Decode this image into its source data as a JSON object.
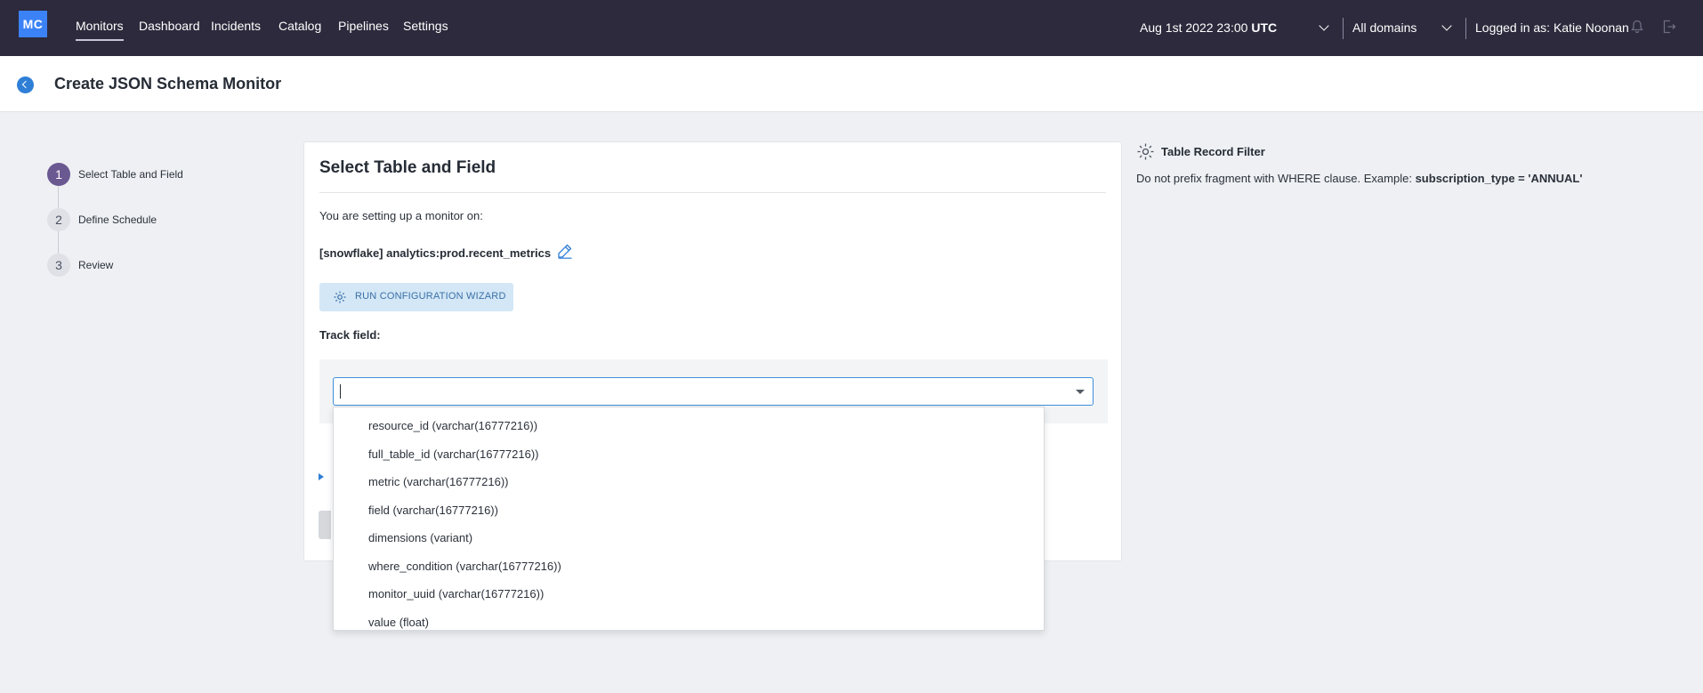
{
  "app": {
    "logo": "MC"
  },
  "nav": {
    "items": [
      "Monitors",
      "Dashboard",
      "Incidents",
      "Catalog",
      "Pipelines",
      "Settings"
    ],
    "active": "Monitors"
  },
  "header": {
    "date": "Aug 1st 2022 23:00",
    "timezone": "UTC",
    "domain_select": "All domains",
    "logged_in": "Logged in as: Katie Noonan"
  },
  "page": {
    "title": "Create JSON Schema Monitor"
  },
  "stepper": {
    "steps": [
      {
        "number": "1",
        "label": "Select Table and Field",
        "active": true
      },
      {
        "number": "2",
        "label": "Define Schedule",
        "active": false
      },
      {
        "number": "3",
        "label": "Review",
        "active": false
      }
    ]
  },
  "card": {
    "title": "Select Table and Field",
    "setup_text": "You are setting up a monitor on:",
    "table_name": "[snowflake] analytics:prod.recent_metrics",
    "wizard_button": "RUN CONFIGURATION WIZARD",
    "track_label": "Track field:",
    "field_value": "",
    "field_placeholder": ""
  },
  "dropdown": {
    "options": [
      "resource_id (varchar(16777216))",
      "full_table_id (varchar(16777216))",
      "metric (varchar(16777216))",
      "field (varchar(16777216))",
      "dimensions (variant)",
      "where_condition (varchar(16777216))",
      "monitor_uuid (varchar(16777216))",
      "value (float)"
    ]
  },
  "right_panel": {
    "title": "Table Record Filter",
    "hint_prefix": "Do not prefix fragment with WHERE clause. Example:",
    "hint_example": "subscription_type = 'ANNUAL'"
  },
  "colors": {
    "topbar": "#2c2a3c",
    "logo_bg": "#3b82f6",
    "accent_blue": "#2f7fd6",
    "step_active": "#6a5891",
    "wizard_bg": "#d3e7f6"
  }
}
